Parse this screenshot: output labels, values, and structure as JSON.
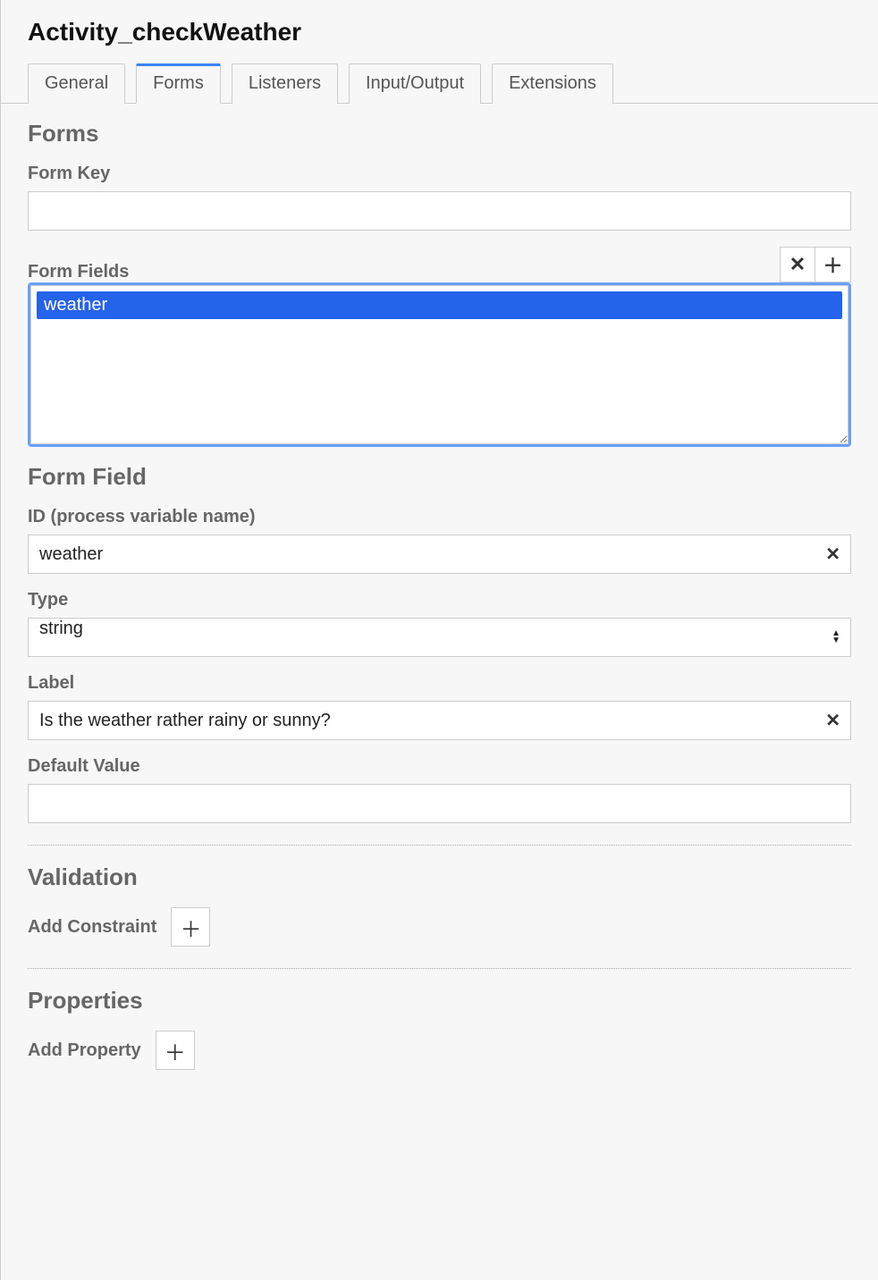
{
  "title": "Activity_checkWeather",
  "tabs": {
    "general": "General",
    "forms": "Forms",
    "listeners": "Listeners",
    "input_output": "Input/Output",
    "extensions": "Extensions"
  },
  "forms": {
    "heading": "Forms",
    "form_key_label": "Form Key",
    "form_key_value": "",
    "form_fields_label": "Form Fields",
    "items": [
      "weather"
    ]
  },
  "form_field": {
    "heading": "Form Field",
    "id_label": "ID (process variable name)",
    "id_value": "weather",
    "type_label": "Type",
    "type_value": "string",
    "label_label": "Label",
    "label_value": "Is the weather rather rainy or sunny?",
    "default_label": "Default Value",
    "default_value": ""
  },
  "validation": {
    "heading": "Validation",
    "add_constraint_label": "Add Constraint"
  },
  "properties": {
    "heading": "Properties",
    "add_property_label": "Add Property"
  }
}
